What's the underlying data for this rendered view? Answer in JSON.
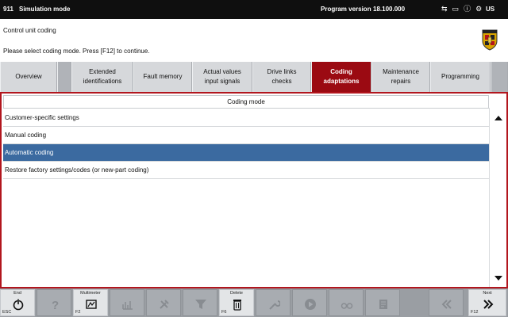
{
  "titlebar": {
    "app_id": "911",
    "mode": "Simulation mode",
    "program_version_label": "Program version",
    "program_version": "18.100.000",
    "language": "US"
  },
  "header": {
    "title": "Control unit coding",
    "instruction": "Please select coding mode. Press [F12] to continue."
  },
  "tabs": [
    {
      "label": "Overview",
      "state": "normal"
    },
    {
      "label": "",
      "state": "dim"
    },
    {
      "label": "Extended\nidentifications",
      "state": "normal"
    },
    {
      "label": "Fault memory",
      "state": "normal"
    },
    {
      "label": "Actual values\ninput signals",
      "state": "normal"
    },
    {
      "label": "Drive links\nchecks",
      "state": "normal"
    },
    {
      "label": "Coding\nadaptations",
      "state": "active"
    },
    {
      "label": "Maintenance\nrepairs",
      "state": "normal"
    },
    {
      "label": "Programming",
      "state": "normal"
    },
    {
      "label": "",
      "state": "dim"
    }
  ],
  "table": {
    "column_header": "Coding mode",
    "rows": [
      {
        "label": "Customer-specific settings",
        "selected": false
      },
      {
        "label": "Manual coding",
        "selected": false
      },
      {
        "label": "Automatic coding",
        "selected": true
      },
      {
        "label": "Restore factory settings/codes (or new-part coding)",
        "selected": false
      }
    ]
  },
  "fkeys": [
    {
      "label": "End",
      "code": "ESC",
      "icon": "power-icon",
      "state": "on"
    },
    {
      "label": "",
      "code": "",
      "icon": "help-icon",
      "state": "off"
    },
    {
      "label": "Multimeter",
      "code": "F2",
      "icon": "multimeter-icon",
      "state": "on"
    },
    {
      "label": "",
      "code": "",
      "icon": "oscilloscope-icon",
      "state": "off"
    },
    {
      "label": "",
      "code": "",
      "icon": "tools-icon",
      "state": "off"
    },
    {
      "label": "",
      "code": "",
      "icon": "filter-icon",
      "state": "off"
    },
    {
      "label": "Delete",
      "code": "F6",
      "icon": "trash-icon",
      "state": "on"
    },
    {
      "label": "",
      "code": "",
      "icon": "wrench-icon",
      "state": "off"
    },
    {
      "label": "",
      "code": "",
      "icon": "play-icon",
      "state": "off"
    },
    {
      "label": "",
      "code": "",
      "icon": "glasses-icon",
      "state": "off"
    },
    {
      "label": "",
      "code": "",
      "icon": "document-icon",
      "state": "off"
    },
    {
      "label": "",
      "code": "",
      "icon": "back-icon",
      "state": "off"
    },
    {
      "label": "Next",
      "code": "F12",
      "icon": "next-icon",
      "state": "on"
    }
  ],
  "colors": {
    "titlebar": "#0f0f0f",
    "accent_red": "#9b0a12",
    "panel_border": "#b2161e",
    "selection": "#3b6aa0"
  }
}
